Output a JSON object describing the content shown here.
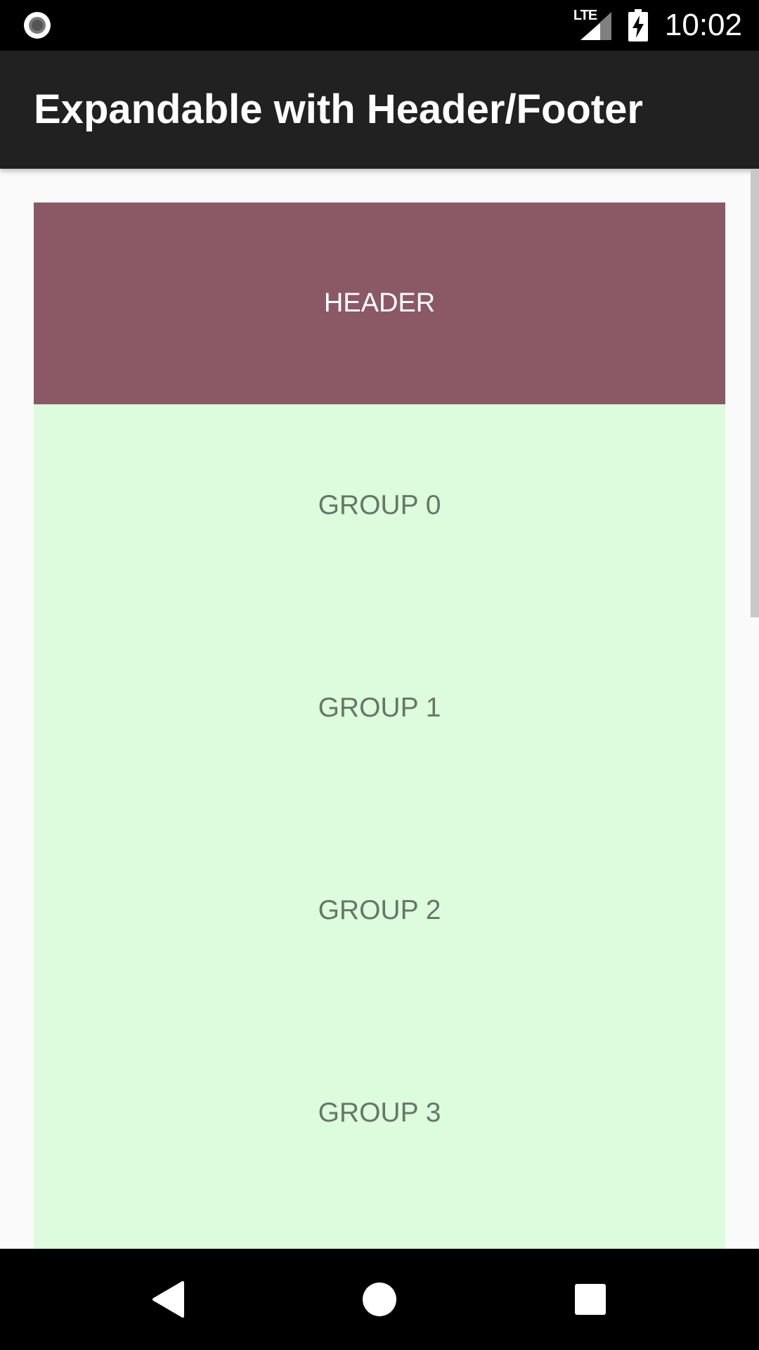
{
  "status_bar": {
    "network_label": "LTE",
    "clock": "10:02",
    "icons": [
      "screen-record-icon",
      "lte-signal-icon",
      "battery-charging-icon"
    ]
  },
  "app_bar": {
    "title": "Expandable with Header/Footer"
  },
  "list": {
    "header_label": "HEADER",
    "groups": [
      {
        "label": "GROUP 0"
      },
      {
        "label": "GROUP 1"
      },
      {
        "label": "GROUP 2"
      },
      {
        "label": "GROUP 3"
      },
      {
        "label": ""
      }
    ]
  },
  "nav_bar": {
    "icons": [
      "back-icon",
      "home-icon",
      "recents-icon"
    ]
  },
  "colors": {
    "status_bar": "#000000",
    "app_bar": "#212121",
    "background": "#fafafa",
    "header": "#8b5965",
    "group_row": "#ddfcdd",
    "group_text": "#667766",
    "nav_bar": "#000000"
  }
}
